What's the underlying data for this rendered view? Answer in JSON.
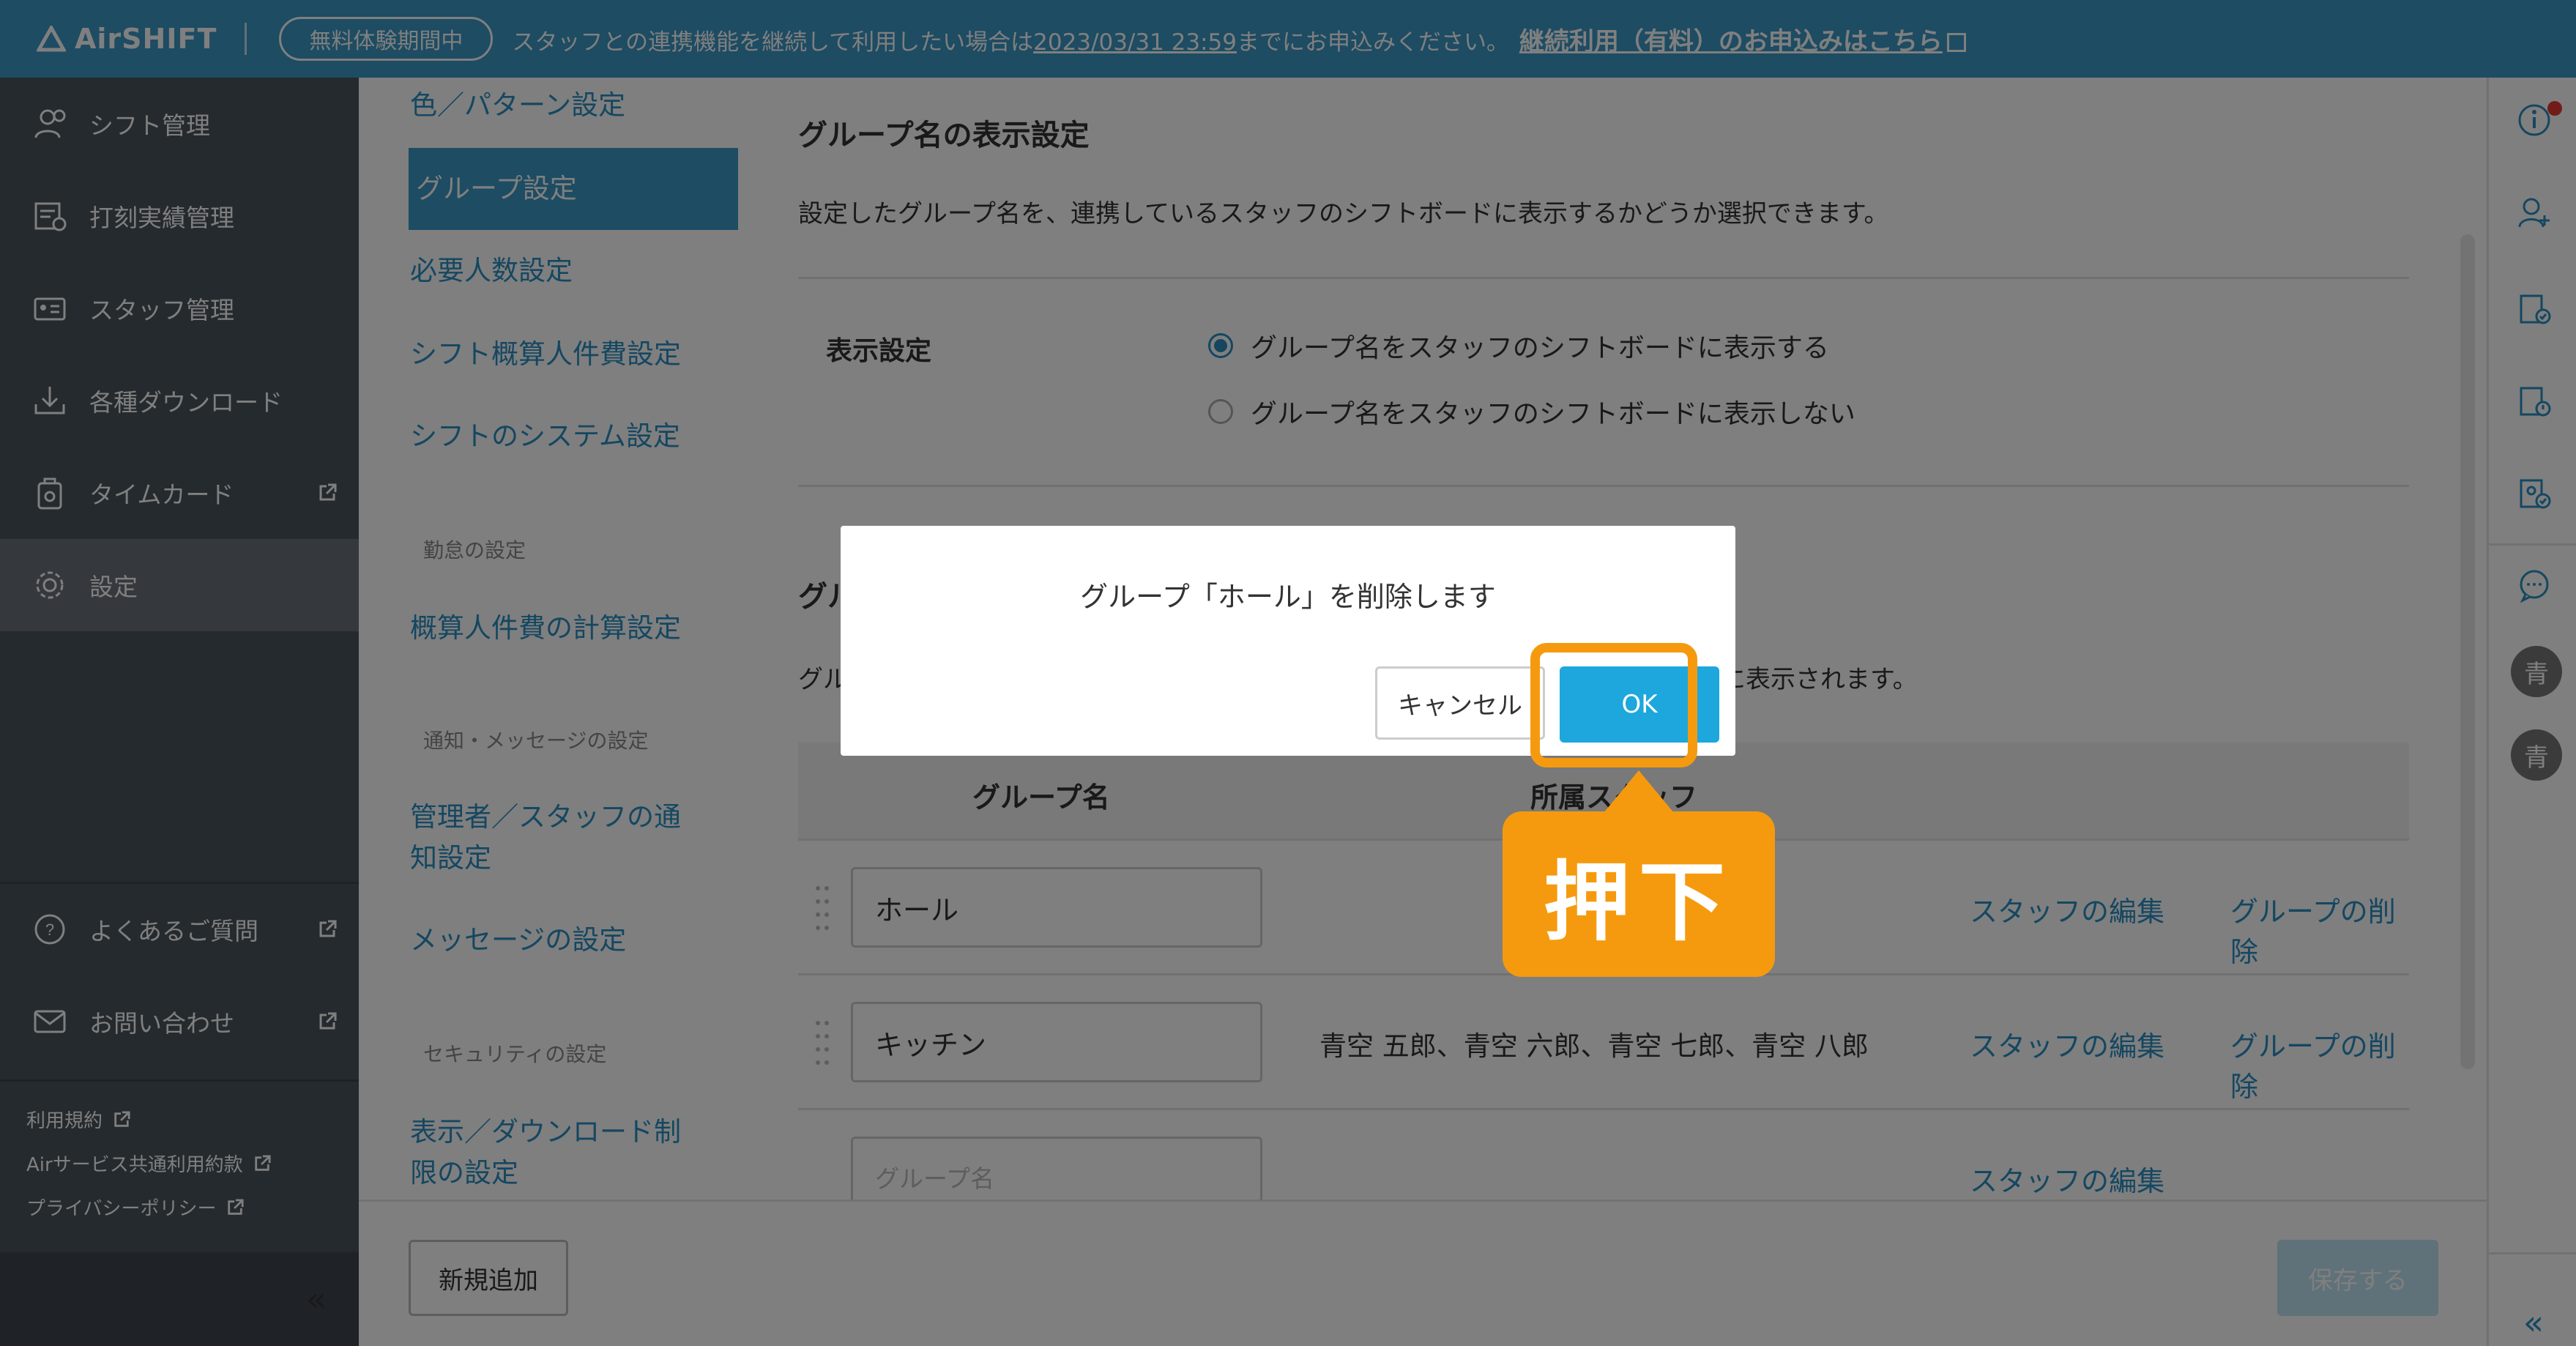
{
  "topbar": {
    "brand": "AirSHIFT",
    "trial_badge": "無料体験期間中",
    "trial_text_before": "スタッフとの連携機能を継続して利用したい場合は",
    "trial_date": "2023/03/31 23:59",
    "trial_text_after": "までにお申込みください。",
    "trial_link": "継続利用（有料）のお申込みはこちら"
  },
  "sidebar": {
    "items": [
      {
        "label": "シフト管理",
        "icon": "shift-icon"
      },
      {
        "label": "打刻実績管理",
        "icon": "timestamp-icon"
      },
      {
        "label": "スタッフ管理",
        "icon": "staff-card-icon"
      },
      {
        "label": "各種ダウンロード",
        "icon": "download-icon"
      },
      {
        "label": "タイムカード",
        "icon": "timecard-icon"
      },
      {
        "label": "設定",
        "icon": "gear-icon"
      }
    ],
    "support": [
      {
        "label": "よくあるご質問",
        "icon": "question-icon"
      },
      {
        "label": "お問い合わせ",
        "icon": "mail-icon"
      }
    ],
    "legal": [
      "利用規約",
      "Airサービス共通利用約款",
      "プライバシーポリシー"
    ],
    "collapse": "«"
  },
  "subnav": {
    "items": [
      "色／パターン設定",
      "グループ設定",
      "必要人数設定",
      "シフト概算人件費設定",
      "シフトのシステム設定"
    ],
    "heading_attendance": "勤怠の設定",
    "attendance_items": [
      "概算人件費の計算設定"
    ],
    "heading_notify": "通知・メッセージの設定",
    "notify_items": [
      "管理者／スタッフの通",
      "知設定",
      "メッセージの設定"
    ],
    "heading_security": "セキュリティの設定",
    "security_items": [
      "表示／ダウンロード制",
      "限の設定"
    ]
  },
  "main": {
    "section_title": "グループ名の表示設定",
    "section_desc": "設定したグループ名を、連携しているスタッフのシフトボードに表示するかどうか選択できます。",
    "display_label": "表示設定",
    "radio_show": "グループ名をスタッフのシフトボードに表示する",
    "radio_hide": "グループ名をスタッフのシフトボードに表示しない",
    "radio_selected": "show",
    "group_title_partial": "グル",
    "group_desc_partial_left": "グル",
    "group_desc_partial_right": "とに表示されます。",
    "table": {
      "col_group": "グループ名",
      "col_staff": "所属スタッフ",
      "rows": [
        {
          "name": "ホール",
          "staff": "",
          "edit": "スタッフの編集",
          "delete": "グループの削除"
        },
        {
          "name": "キッチン",
          "staff": "青空 五郎、青空 六郎、青空 七郎、青空 八郎",
          "edit": "スタッフの編集",
          "delete": "グループの削除"
        }
      ],
      "new_placeholder": "グループ名",
      "new_edit": "スタッフの編集"
    }
  },
  "bottombar": {
    "add_label": "新規追加",
    "save_label": "保存する"
  },
  "rightrail": {
    "avatar_1": "青",
    "avatar_2": "青",
    "collapse": "«"
  },
  "dialog": {
    "message": "グループ「ホール」を削除します",
    "cancel_label": "キャンセル",
    "ok_label": "OK"
  },
  "callout": {
    "text": "押下"
  },
  "colors": {
    "brand": "#3a98c6",
    "link": "#2a8fc2",
    "sidebar": "#4a545c",
    "highlight": "#f59a0e",
    "ok_button": "#1da7dd"
  }
}
